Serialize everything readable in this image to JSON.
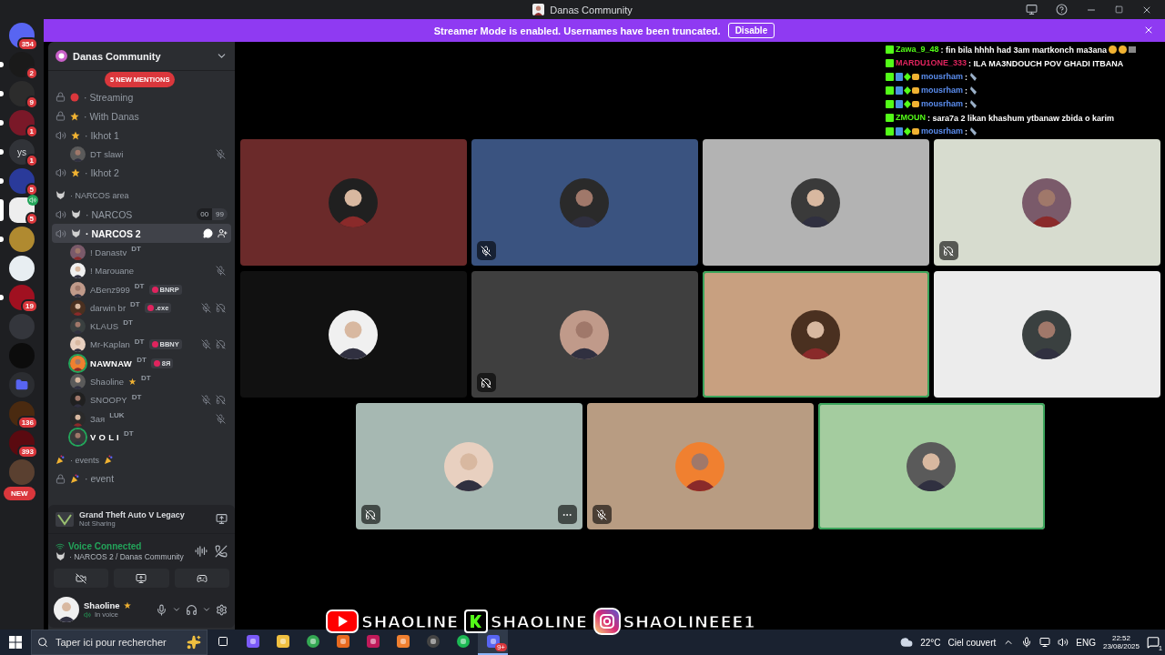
{
  "window": {
    "title": "Danas Community"
  },
  "banner": {
    "text": "Streamer Mode is enabled. Usernames have been truncated.",
    "button": "Disable"
  },
  "servers": [
    {
      "kind": "server",
      "color": "#5865f2",
      "badge": "354",
      "unread": false,
      "selected": false
    },
    {
      "kind": "server",
      "color": "#1a1a1a",
      "badge": "2",
      "unread": true,
      "selected": false
    },
    {
      "kind": "server",
      "color": "#2c2c2c",
      "badge": "9",
      "unread": true,
      "selected": false
    },
    {
      "kind": "server",
      "color": "#7a1828",
      "badge": "1",
      "unread": true,
      "selected": false
    },
    {
      "kind": "server",
      "color": "#313338",
      "label": "ys",
      "badge": "1",
      "unread": true,
      "selected": false
    },
    {
      "kind": "server",
      "color": "#2a3a9a",
      "badge": "5",
      "unread": true,
      "selected": false
    },
    {
      "kind": "server",
      "color": "#eeeeee",
      "badge": "5",
      "unread": false,
      "selected": true,
      "in_voice": true
    },
    {
      "kind": "server",
      "color": "#b08a30",
      "unread": true,
      "selected": false
    },
    {
      "kind": "server",
      "color": "#e8eef2",
      "unread": false,
      "selected": false
    },
    {
      "kind": "server",
      "color": "#a01020",
      "badge": "19",
      "unread": true,
      "selected": false
    },
    {
      "kind": "server",
      "color": "#34363c",
      "unread": false,
      "selected": false
    },
    {
      "kind": "server",
      "color": "#0c0c0c",
      "unread": false,
      "selected": false
    },
    {
      "kind": "folder",
      "color": "#5865f2",
      "unread": false,
      "selected": false
    },
    {
      "kind": "server",
      "color": "#4a2a10",
      "badge": "136",
      "unread": false,
      "selected": false
    },
    {
      "kind": "server",
      "color": "#5a0a10",
      "badge": "393",
      "unread": false,
      "selected": false
    },
    {
      "kind": "server",
      "color": "#5a4030",
      "pill": "NEW",
      "unread": false,
      "selected": false
    }
  ],
  "server_header": {
    "name": "Danas Community"
  },
  "mentions_badge": "5 NEW MENTIONS",
  "channel_list": [
    {
      "kind": "locked",
      "emblem": {
        "kind": "dot"
      },
      "name": "· Streaming",
      "selected": false
    },
    {
      "kind": "locked",
      "emblem": {
        "kind": "star"
      },
      "name": "· With Danas",
      "selected": false
    },
    {
      "kind": "voice",
      "emblem": {
        "kind": "star"
      },
      "name": "· Ikhot 1",
      "selected": false,
      "users": [
        {
          "name": "DT slawi",
          "muted": true,
          "deafened": false,
          "speaking": false
        }
      ]
    },
    {
      "kind": "voice",
      "emblem": {
        "kind": "star"
      },
      "name": "· Ikhot 2",
      "selected": false
    },
    {
      "kind": "category",
      "emblem": {
        "kind": "wolf"
      },
      "name": "· NARCOS area"
    },
    {
      "kind": "voice",
      "emblem": {
        "kind": "wolf"
      },
      "name": "· NARCOS",
      "selected": false,
      "user_count": "00",
      "user_limit": "99"
    },
    {
      "kind": "voice",
      "emblem": {
        "kind": "wolf"
      },
      "name": "· NARCOS 2",
      "selected": true,
      "users": [
        {
          "name": "! Danastv",
          "tag": "DT",
          "muted": false,
          "deafened": false,
          "speaking": false
        },
        {
          "name": "! Marouane",
          "muted": true,
          "deafened": false,
          "speaking": false
        },
        {
          "name": "ABenz999",
          "tag": "DT",
          "clan": "BNRP",
          "muted": false,
          "deafened": false,
          "speaking": false
        },
        {
          "name": "darwin br",
          "tag": "DT",
          "clan": ".exe",
          "muted": true,
          "deafened": true,
          "speaking": false
        },
        {
          "name": "KLAUS",
          "tag": "DT",
          "muted": false,
          "deafened": false,
          "speaking": false
        },
        {
          "name": "Mr-Kaplan",
          "tag": "DT",
          "clan": "BBNY",
          "muted": true,
          "deafened": true,
          "speaking": false
        },
        {
          "name": "NAWNAW",
          "tag": "DT",
          "clan": "8Я",
          "muted": false,
          "deafened": false,
          "speaking": true
        },
        {
          "name": "Shaoline",
          "star": "★",
          "tag": "DT",
          "muted": false,
          "deafened": false,
          "speaking": false
        },
        {
          "name": "SNOOPY",
          "tag": "DT",
          "muted": true,
          "deafened": true,
          "speaking": false
        },
        {
          "name": "Зая",
          "tag": "LUK",
          "muted": true,
          "deafened": false,
          "speaking": false
        },
        {
          "name": "V O L I",
          "tag": "DT",
          "muted": false,
          "deafened": false,
          "speaking": true
        }
      ]
    },
    {
      "kind": "category",
      "emblem": {
        "kind": "party"
      },
      "name": "· events"
    },
    {
      "kind": "locked",
      "emblem": {
        "kind": "party"
      },
      "name": "· event",
      "selected": false
    }
  ],
  "activity": {
    "title": "Grand Theft Auto V Legacy",
    "subtitle": "Not Sharing"
  },
  "voice_status": {
    "status": "Voice Connected",
    "location": "· NARCOS 2 / Danas Community"
  },
  "user_panel": {
    "name": "Shaoline",
    "star": "★",
    "status": "In voice"
  },
  "tiles": [
    {
      "color": "#6b2a2a",
      "muted": false,
      "deafened": false,
      "speaking": false,
      "more": false
    },
    {
      "color": "#3a5380",
      "muted": true,
      "deafened": false,
      "speaking": false,
      "more": false
    },
    {
      "color": "#b3b3b3",
      "muted": false,
      "deafened": false,
      "speaking": false,
      "more": false
    },
    {
      "color": "#d7dccf",
      "muted": false,
      "deafened": true,
      "speaking": false,
      "more": false
    },
    {
      "color": "#111111",
      "muted": false,
      "deafened": false,
      "speaking": false,
      "more": false
    },
    {
      "color": "#3f3f3f",
      "muted": false,
      "deafened": true,
      "speaking": false,
      "more": false
    },
    {
      "color": "#c8a080",
      "muted": false,
      "deafened": false,
      "speaking": true,
      "more": false
    },
    {
      "color": "#ececec",
      "muted": false,
      "deafened": false,
      "speaking": false,
      "more": false
    },
    {
      "color": "#a6b8b2",
      "muted": false,
      "deafened": true,
      "speaking": false,
      "more": true
    },
    {
      "color": "#b89c82",
      "muted": true,
      "deafened": false,
      "speaking": false,
      "more": false
    },
    {
      "color": "#a4cc9f",
      "muted": false,
      "deafened": false,
      "speaking": true,
      "more": false
    }
  ],
  "chat_overlay": [
    {
      "kind": "emoji",
      "user": "Zawa_9_48",
      "color": "#53fc18",
      "message": ": fin bila hhhh had 3am martkonch ma3ana"
    },
    {
      "kind": "text",
      "user": "MARDU1ONE_333",
      "color": "#e0245e",
      "message": ": ILA MA3NDOUCH POV GHADI ITBANA"
    },
    {
      "kind": "sticker",
      "user": "mousrham",
      "color": "#5b8ef0",
      "message": ":"
    },
    {
      "kind": "sticker",
      "user": "mousrham",
      "color": "#5b8ef0",
      "message": ":"
    },
    {
      "kind": "sticker",
      "user": "mousrham",
      "color": "#5b8ef0",
      "message": ":"
    },
    {
      "kind": "text",
      "user": "ZMOUN",
      "color": "#53fc18",
      "message": ": sara7a 2 likan khashum ytbanaw zbida o karim"
    },
    {
      "kind": "sticker",
      "user": "mousrham",
      "color": "#5b8ef0",
      "message": ":"
    }
  ],
  "social_overlay": [
    {
      "kind": "youtube",
      "handle": "SHAOLINE"
    },
    {
      "kind": "kick",
      "handle": "SHAOLINE"
    },
    {
      "kind": "instagram",
      "handle": "SHAOLINEEE1"
    }
  ],
  "taskbar": {
    "search": {
      "placeholder": "Taper ici pour rechercher"
    },
    "apps": [
      {
        "kind": "copilot",
        "selected": false
      },
      {
        "kind": "files",
        "selected": false
      },
      {
        "kind": "chrome",
        "selected": false
      },
      {
        "kind": "office",
        "selected": false
      },
      {
        "kind": "editor",
        "selected": false
      },
      {
        "kind": "studio",
        "selected": false
      },
      {
        "kind": "obs",
        "selected": false
      },
      {
        "kind": "spotify",
        "selected": false
      },
      {
        "kind": "discord",
        "selected": true,
        "badge": "9+"
      }
    ],
    "weather": {
      "temp": "22°C",
      "condition": "Ciel couvert"
    },
    "language": "ENG",
    "time": "22:52",
    "date": "23/08/2025",
    "notifications": "1"
  }
}
